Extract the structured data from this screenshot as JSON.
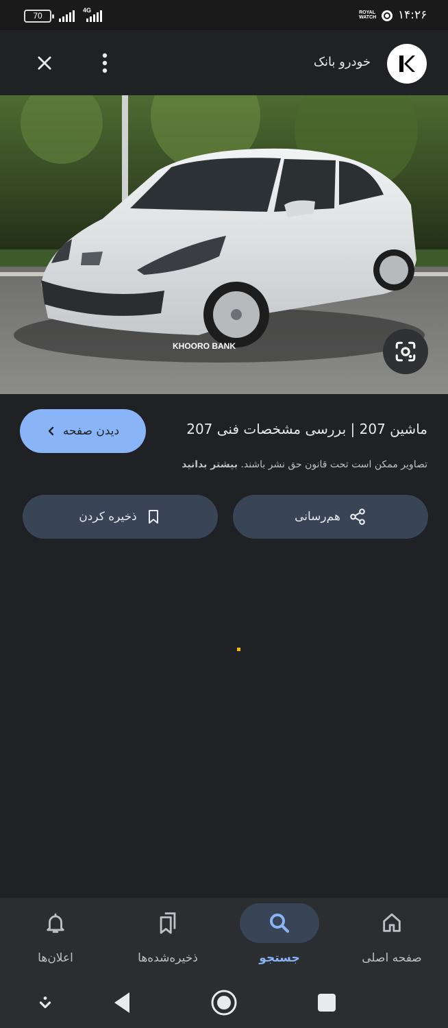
{
  "status_bar": {
    "battery": "70",
    "network": "4G",
    "carrier_badge": "ROYAL WATCH",
    "time": "۱۴:۲۶"
  },
  "top_bar": {
    "site_name": "خودرو بانک",
    "logo_letter": "K"
  },
  "image": {
    "watermark": "KHOORO BANK"
  },
  "result": {
    "title": "ماشین 207 | بررسی مشخصات فنی 207",
    "visit_label": "دیدن صفحه",
    "copyright_text": "تصاویر ممکن است تحت قانون حق نشر باشند.",
    "learn_more": "بیشتر بدانید"
  },
  "actions": {
    "share_label": "هم‌رسانی",
    "save_label": "ذخیره کردن"
  },
  "bottom_nav": {
    "items": [
      {
        "label": "صفحه اصلی",
        "icon": "home-icon"
      },
      {
        "label": "جستجو",
        "icon": "search-icon",
        "active": true
      },
      {
        "label": "ذخیره‌شده‌ها",
        "icon": "bookmarks-icon"
      },
      {
        "label": "اعلان‌ها",
        "icon": "bell-icon"
      }
    ]
  },
  "colors": {
    "accent": "#8ab4f8",
    "background": "#202124",
    "button": "#394457"
  }
}
